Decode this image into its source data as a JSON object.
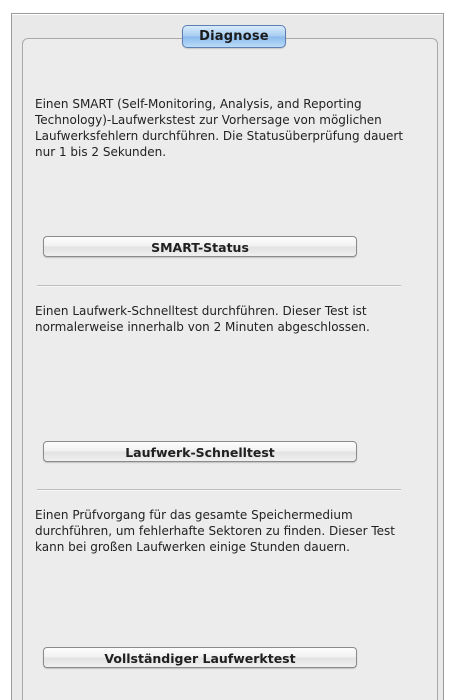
{
  "panel": {
    "tab_label": "Diagnose"
  },
  "sections": [
    {
      "description": "Einen SMART (Self-Monitoring, Analysis, and Reporting Technology)-Laufwerkstest zur Vorhersage von möglichen Laufwerksfehlern durchführen. Die Statusüberprüfung dauert nur 1 bis 2 Sekunden.",
      "button_label": "SMART-Status"
    },
    {
      "description": "Einen Laufwerk-Schnelltest durchführen. Dieser Test ist normalerweise innerhalb von 2 Minuten abgeschlossen.",
      "button_label": "Laufwerk-Schnelltest"
    },
    {
      "description": "Einen Prüfvorgang für das gesamte Speichermedium durchführen, um fehlerhafte Sektoren zu finden. Dieser Test kann bei großen Laufwerken einige Stunden dauern.",
      "button_label": "Vollständiger Laufwerktest"
    }
  ]
}
